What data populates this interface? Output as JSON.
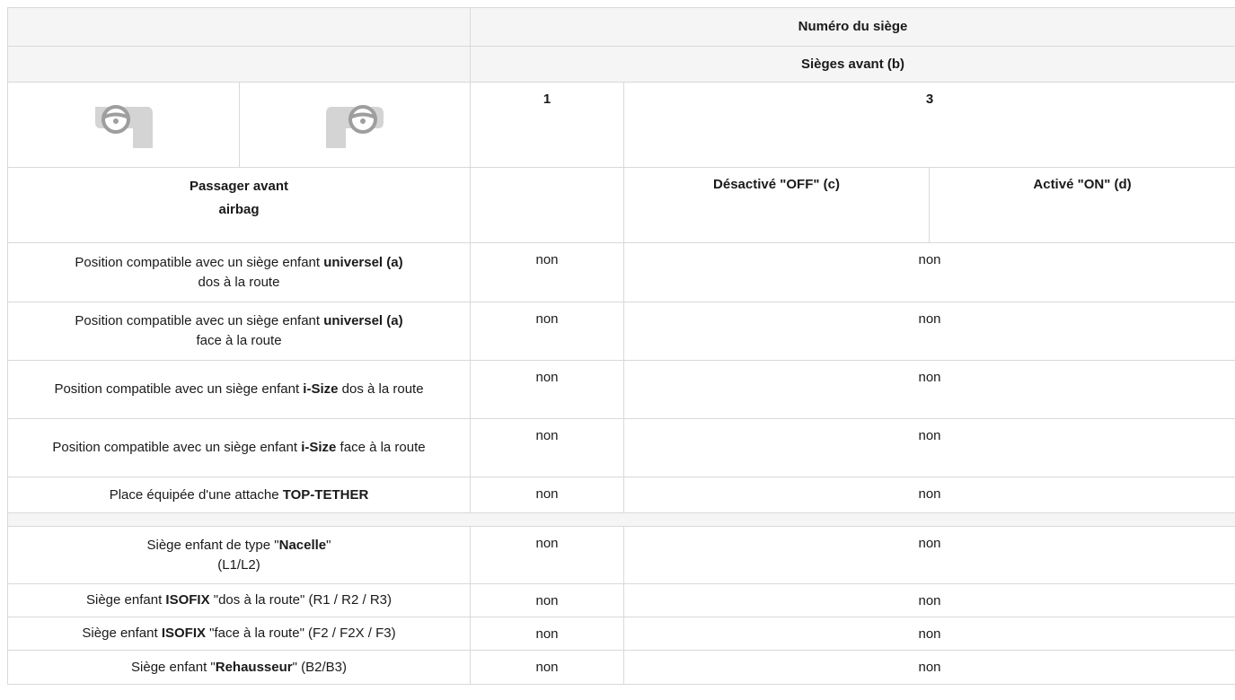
{
  "header": {
    "seat_number": "Numéro du siège",
    "front_seats": "Sièges avant (b)",
    "seat_1": "1",
    "seat_3": "3",
    "airbag_line1": "Passager avant",
    "airbag_line2": "airbag",
    "off_label": "Désactivé \"OFF\" (c)",
    "on_label": "Activé \"ON\" (d)"
  },
  "icons": {
    "lhd": "left-hand-drive-icon",
    "rhd": "right-hand-drive-icon",
    "icon_color": "#d4d4d4"
  },
  "rows": [
    {
      "pre": "Position compatible avec un siège enfant ",
      "bold": "universel (a)",
      "post": "dos à la route",
      "seat1": "non",
      "seat3": "non"
    },
    {
      "pre": "Position compatible avec un siège enfant ",
      "bold": "universel (a)",
      "post": "face à la route",
      "seat1": "non",
      "seat3": "non"
    },
    {
      "pre": "Position compatible avec un siège enfant ",
      "bold": "i-Size",
      "post": " dos à la route",
      "seat1": "non",
      "seat3": "non"
    },
    {
      "pre": "Position compatible avec un siège enfant ",
      "bold": "i-Size",
      "post": " face à la route",
      "seat1": "non",
      "seat3": "non"
    },
    {
      "pre": "Place équipée d'une attache ",
      "bold": "TOP-TETHER",
      "post": "",
      "seat1": "non",
      "seat3": "non"
    }
  ],
  "rows2": [
    {
      "pre": "Siège enfant de type \"",
      "bold": "Nacelle",
      "post": "\"",
      "sub": "(L1/L2)",
      "seat1": "non",
      "seat3": "non"
    },
    {
      "pre": "Siège enfant ",
      "bold": "ISOFIX",
      "post": " \"dos à la route\" (R1 / R2 / R3)",
      "seat1": "non",
      "seat3": "non"
    },
    {
      "pre": "Siège enfant ",
      "bold": "ISOFIX",
      "post": " \"face à la route\" (F2 / F2X / F3)",
      "seat1": "non",
      "seat3": "non"
    },
    {
      "pre": "Siège enfant \"",
      "bold": "Rehausseur",
      "post": "\" (B2/B3)",
      "seat1": "non",
      "seat3": "non"
    }
  ]
}
